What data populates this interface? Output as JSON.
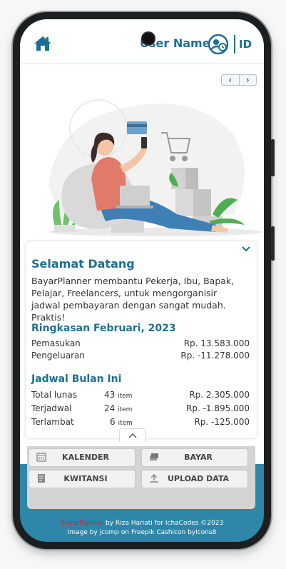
{
  "header": {
    "user_name": "User Name",
    "language": "ID"
  },
  "illustration_nav": {
    "prev": "‹",
    "next": "›"
  },
  "welcome": {
    "title": "Selamat Datang",
    "description": "BayarPlanner membantu Pekerja, Ibu, Bapak, Pelajar, Freelancers, untuk mengorganisir jadwal pembayaran dengan sangat mudah. Praktis!"
  },
  "summary": {
    "title": "Ringkasan Februari, 2023",
    "rows": [
      {
        "label": "Pemasukan",
        "value": "Rp. 13.583.000"
      },
      {
        "label": "Pengeluaran",
        "value": "Rp. -11.278.000"
      }
    ]
  },
  "schedule": {
    "title": "Jadwal Bulan Ini",
    "rows": [
      {
        "label": "Total lunas",
        "count": "43",
        "unit": "item",
        "value": "Rp. 2.305.000"
      },
      {
        "label": "Terjadwal",
        "count": "24",
        "unit": "item",
        "value": "Rp. -1.895.000"
      },
      {
        "label": "Terlambat",
        "count": "6",
        "unit": "item",
        "value": "Rp. -125.000"
      }
    ]
  },
  "actions": {
    "kalender": "KALENDER",
    "bayar": "BAYAR",
    "kwitansi": "KWITANSI",
    "upload": "UPLOAD DATA"
  },
  "footer": {
    "brand": "BayarPlanner",
    "credit_line1": " by Riza Hariati for IchaCodes ©2023",
    "credit_line2": "Image by jcomp  on Freepik Cashicon byIcons8"
  },
  "colors": {
    "accent": "#1d6f92",
    "screen_bg": "#2e86a8",
    "brand_red": "#e02020"
  },
  "icons": [
    "home-icon",
    "user-clock-icon",
    "chevron-down-icon",
    "chevron-up-icon",
    "calendar-icon",
    "money-icon",
    "receipt-icon",
    "upload-icon"
  ]
}
